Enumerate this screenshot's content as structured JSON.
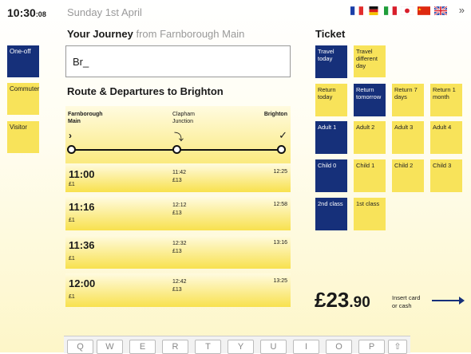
{
  "header": {
    "clock_main": "10:30",
    "clock_sec": ":08",
    "date": "Sunday 1st April",
    "more": "»"
  },
  "flags": [
    {
      "name": "france-flag-icon",
      "colors": [
        "#1b3fa8",
        "#ffffff",
        "#e22d2d"
      ]
    },
    {
      "name": "germany-flag-icon",
      "colors": [
        "#111111",
        "#d91b1b",
        "#f5c400"
      ]
    },
    {
      "name": "italy-flag-icon",
      "colors": [
        "#1f9d3a",
        "#ffffff",
        "#d81e2b"
      ]
    },
    {
      "name": "japan-flag-icon",
      "colors": [
        "#ffffff",
        "#d81e2b"
      ]
    },
    {
      "name": "china-flag-icon",
      "colors": [
        "#de2910",
        "#ffde00"
      ]
    },
    {
      "name": "uk-flag-icon",
      "colors": [
        "#1b3fa8",
        "#ffffff",
        "#d81e2b"
      ]
    }
  ],
  "left_menu": [
    {
      "label": "One-off",
      "selected": true
    },
    {
      "label": "Commuter",
      "selected": false
    },
    {
      "label": "Visitor",
      "selected": false
    }
  ],
  "journey": {
    "title": "Your Journey",
    "from": "from Farnborough Main",
    "input_value": "Br_"
  },
  "route": {
    "title": "Route & Departures to Brighton",
    "stations": [
      {
        "name_line1": "Farnborough",
        "name_line2": "Main",
        "icon": "›"
      },
      {
        "name_line1": "Clapham",
        "name_line2": "Junction",
        "icon": "⤵"
      },
      {
        "name_line1": "Brighton",
        "name_line2": "",
        "icon": "✓"
      }
    ],
    "departures": [
      {
        "time": "11:00",
        "fare1": "£1",
        "mid_time": "11:42",
        "fare2": "£13",
        "arrive": "12:25"
      },
      {
        "time": "11:16",
        "fare1": "£1",
        "mid_time": "12:12",
        "fare2": "£13",
        "arrive": "12:58"
      },
      {
        "time": "11:36",
        "fare1": "£1",
        "mid_time": "12:32",
        "fare2": "£13",
        "arrive": "13:16"
      },
      {
        "time": "12:00",
        "fare1": "£1",
        "mid_time": "12:42",
        "fare2": "£13",
        "arrive": "13:25"
      }
    ]
  },
  "ticket": {
    "title": "Ticket",
    "rows": [
      [
        {
          "label": "Travel today",
          "selected": true
        },
        {
          "label": "Travel different day",
          "selected": false
        }
      ],
      [
        {
          "label": "Return today",
          "selected": false
        },
        {
          "label": "Return tomorrow",
          "selected": true
        },
        {
          "label": "Return 7 days",
          "selected": false
        },
        {
          "label": "Return 1 month",
          "selected": false
        }
      ],
      [
        {
          "label": "Adult 1",
          "selected": true
        },
        {
          "label": "Adult 2",
          "selected": false
        },
        {
          "label": "Adult 3",
          "selected": false
        },
        {
          "label": "Adult 4",
          "selected": false
        }
      ],
      [
        {
          "label": "Child 0",
          "selected": true
        },
        {
          "label": "Child 1",
          "selected": false
        },
        {
          "label": "Child 2",
          "selected": false
        },
        {
          "label": "Child 3",
          "selected": false
        }
      ],
      [
        {
          "label": "2nd class",
          "selected": true
        },
        {
          "label": "1st class",
          "selected": false
        }
      ]
    ],
    "price_main": "£23",
    "price_dec": ".90",
    "insert_line1": "Insert card",
    "insert_line2": "or cash"
  },
  "keyboard": {
    "keys": [
      "Q",
      "W",
      "E",
      "R",
      "T",
      "Y",
      "U",
      "I",
      "O",
      "P"
    ],
    "shift": "⇧"
  },
  "colors": {
    "blue": "#16307a",
    "yellow": "#f8e35a"
  }
}
